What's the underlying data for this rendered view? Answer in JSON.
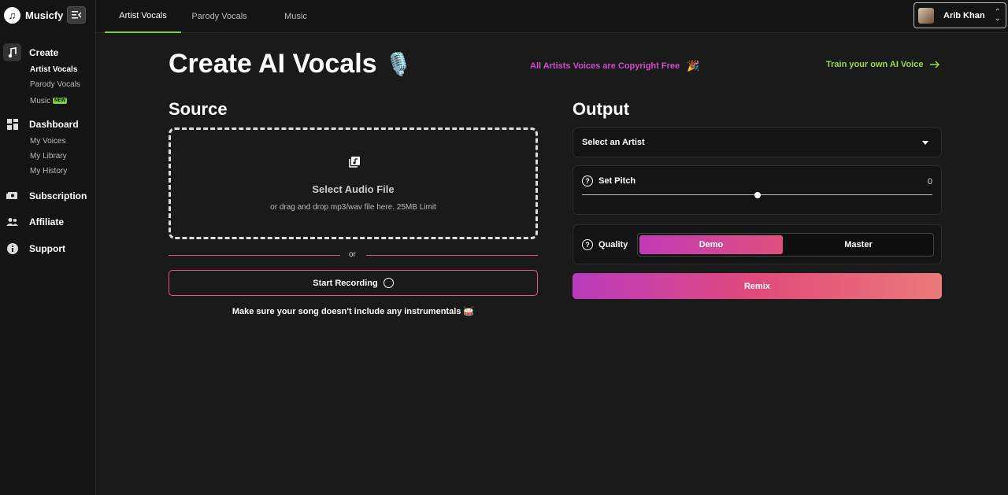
{
  "app": {
    "name": "Musicfy"
  },
  "sidebar": {
    "sections": [
      {
        "label": "Create",
        "icon": "music-note-icon",
        "items": [
          "Artist Vocals",
          "Parody Vocals",
          "Music"
        ]
      },
      {
        "label": "Dashboard",
        "icon": "dashboard-icon",
        "items": [
          "My Voices",
          "My Library",
          "My History"
        ]
      },
      {
        "label": "Subscription",
        "icon": "subscription-icon"
      },
      {
        "label": "Affiliate",
        "icon": "affiliate-icon"
      },
      {
        "label": "Support",
        "icon": "info-icon"
      }
    ],
    "new_badge": "NEW",
    "active_item": "Artist Vocals"
  },
  "topbar": {
    "tabs": [
      "Artist Vocals",
      "Parody Vocals",
      "Music"
    ],
    "active_tab": "Artist Vocals",
    "user": {
      "name": "Arib Khan"
    }
  },
  "main": {
    "title": "Create AI Vocals",
    "title_emoji": "🎙️",
    "copyright_note": "All Artists Voices are Copyright Free",
    "copyright_emoji": "🎉",
    "train_link": "Train your own AI Voice",
    "source": {
      "heading": "Source",
      "dropzone_title": "Select Audio File",
      "dropzone_sub": "or drag and drop mp3/wav file here. 25MB Limit",
      "or_text": "or",
      "record_label": "Start Recording",
      "hint": "Make sure your song doesn't include any instrumentals 🥁"
    },
    "output": {
      "heading": "Output",
      "select_artist_placeholder": "Select an Artist",
      "pitch": {
        "label": "Set Pitch",
        "value": "0",
        "position_fraction": 0.5
      },
      "quality": {
        "label": "Quality",
        "options": [
          "Demo",
          "Master"
        ],
        "selected": "Demo"
      },
      "remix_label": "Remix"
    }
  },
  "colors": {
    "accent_green": "#7dd13a",
    "accent_pink": "#e0507e",
    "accent_magenta": "#c13ab6"
  }
}
